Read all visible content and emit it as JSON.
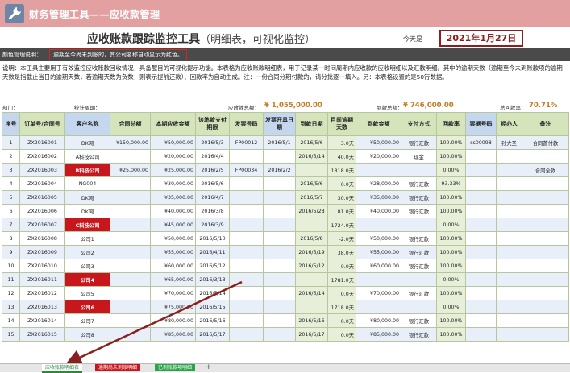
{
  "banner": {
    "title": "财务管理工具——应收款管理",
    "logo_icon": "wrench-icon"
  },
  "header": {
    "title": "应收账款跟踪监控工具",
    "subtitle": "（明细表，可视化监控）",
    "today_label": "今天是",
    "today_date": "2021年1月27日"
  },
  "legend": {
    "label": "颜色管理说明：",
    "note": "逾期至今尚未到账的，其公司名称自动显示为红色。"
  },
  "description": "说明：本工具主要用于有效监控应收账款回收情况，具备醒目的可视化提示功能。本表格为应收账款明细表，用于记录某一时间周期内应收款的应收明细以及汇款明细。其中的逾期天数（逾期至今未到账款项的逾期天数是指截止当日的逾期天数，若逾期天数为负数，则表示提前还款）、回款率为自动生成。注：一份合同分期付款的，请分批逐一填入。另：本表格设置的是50行数据。",
  "summary": {
    "dept_label": "部门：",
    "period_label": "统计周期：",
    "receivable_label": "应收款总额：",
    "receivable_value": "¥ 1,055,000.00",
    "received_label": "到款总额：",
    "received_value": "¥ 746,000.00",
    "rate_label": "总回款率：",
    "rate_value": "70.71%"
  },
  "columns": [
    "序号",
    "订单号/合同号",
    "客户名称",
    "合同总额",
    "本期应收金额",
    "该笔款支付期限",
    "发票号码",
    "发票开具日期",
    "到款日期",
    "目前逾期天数",
    "到款金额",
    "支付方式",
    "回款率",
    "票据号码",
    "经办人",
    "备注"
  ],
  "rows": [
    [
      "1",
      "ZX2016001",
      "DK网",
      "¥150,000.00",
      "¥50,000.00",
      "2016/5/3",
      "FP00012",
      "2016/5/1",
      "2016/5/6",
      "3.0天",
      "¥50,000.00",
      "银行汇款",
      "100.00%",
      "ss00098",
      "孙大圣",
      "合同首付款"
    ],
    [
      "2",
      "ZX2016002",
      "A科技公司",
      "",
      "¥20,000.00",
      "2016/4/4",
      "",
      "",
      "2016/5/14",
      "40.0天",
      "¥20,000.00",
      "现金",
      "100.00%",
      "",
      "",
      ""
    ],
    [
      "3",
      "ZX2016003",
      "B科技公司",
      "¥25,000.00",
      "¥25,000.00",
      "2016/2/5",
      "FP00034",
      "2016/2/2",
      "",
      "1818.0天",
      "",
      "",
      "0.00%",
      "",
      "",
      "合同全款"
    ],
    [
      "4",
      "ZX2016004",
      "NG004",
      "",
      "¥30,000.00",
      "2016/5/6",
      "",
      "",
      "2016/5/6",
      "0.0天",
      "¥28,000.00",
      "银行汇款",
      "93.33%",
      "",
      "",
      ""
    ],
    [
      "5",
      "ZX2016005",
      "DK网",
      "",
      "¥35,000.00",
      "2016/4/7",
      "",
      "",
      "2016/5/7",
      "30.0天",
      "¥35,000.00",
      "银行汇款",
      "100.00%",
      "",
      "",
      ""
    ],
    [
      "6",
      "ZX2016006",
      "DK网",
      "",
      "¥40,000.00",
      "2016/3/8",
      "",
      "",
      "2016/5/28",
      "81.0天",
      "¥40,000.00",
      "银行汇款",
      "100.00%",
      "",
      "",
      ""
    ],
    [
      "7",
      "ZX2016007",
      "C科技公司",
      "",
      "¥45,000.00",
      "2016/3/9",
      "",
      "",
      "",
      "1724.0天",
      "",
      "",
      "0.00%",
      "",
      "",
      ""
    ],
    [
      "8",
      "ZX2016008",
      "公司1",
      "",
      "¥50,000.00",
      "2016/5/10",
      "",
      "",
      "2016/5/8",
      "-2.0天",
      "¥50,000.00",
      "银行汇款",
      "100.00%",
      "",
      "",
      ""
    ],
    [
      "9",
      "ZX2016009",
      "公司2",
      "",
      "¥55,000.00",
      "2016/4/11",
      "",
      "",
      "2016/5/19",
      "38.0天",
      "¥55,000.00",
      "银行汇款",
      "100.00%",
      "",
      "",
      ""
    ],
    [
      "10",
      "ZX2016010",
      "公司3",
      "",
      "¥60,000.00",
      "2016/5/12",
      "",
      "",
      "2016/5/12",
      "0.0天",
      "¥60,000.00",
      "银行汇款",
      "100.00%",
      "",
      "",
      ""
    ],
    [
      "11",
      "ZX2016011",
      "公司4",
      "",
      "¥65,000.00",
      "2016/3/13",
      "",
      "",
      "",
      "1781.0天",
      "",
      "",
      "0.00%",
      "",
      "",
      ""
    ],
    [
      "12",
      "ZX2016012",
      "公司5",
      "",
      "¥70,000.00",
      "2016/5/14",
      "",
      "",
      "2016/5/14",
      "0.0天",
      "¥70,000.00",
      "银行汇款",
      "100.00%",
      "",
      "",
      ""
    ],
    [
      "13",
      "ZX2016013",
      "公司6",
      "",
      "¥75,000.00",
      "2016/5/15",
      "",
      "",
      "",
      "1718.0天",
      "",
      "",
      "0.00%",
      "",
      "",
      ""
    ],
    [
      "14",
      "ZX2016014",
      "公司7",
      "",
      "¥80,000.00",
      "2016/5/16",
      "",
      "",
      "2016/5/16",
      "0.0天",
      "¥80,000.00",
      "银行汇款",
      "100.00%",
      "",
      "",
      ""
    ],
    [
      "15",
      "ZX2016015",
      "公司8",
      "",
      "¥85,000.00",
      "2016/5/17",
      "",
      "",
      "2016/5/17",
      "0.0天",
      "¥85,000.00",
      "银行汇款",
      "100.00%",
      "",
      "",
      ""
    ]
  ],
  "overdue_rows": [
    3,
    7,
    11,
    13
  ],
  "tabs": [
    "应收账款明细表",
    "逾期尚未到账明细",
    "已到账款项明细"
  ],
  "colors": {
    "banner": "#e3a0a0",
    "overdue_red": "#c8161d",
    "date_border": "#8b1f1f",
    "accent_orange": "#c47a1e",
    "tab_green": "#2aa34a",
    "arrow": "#8b1f1f"
  }
}
